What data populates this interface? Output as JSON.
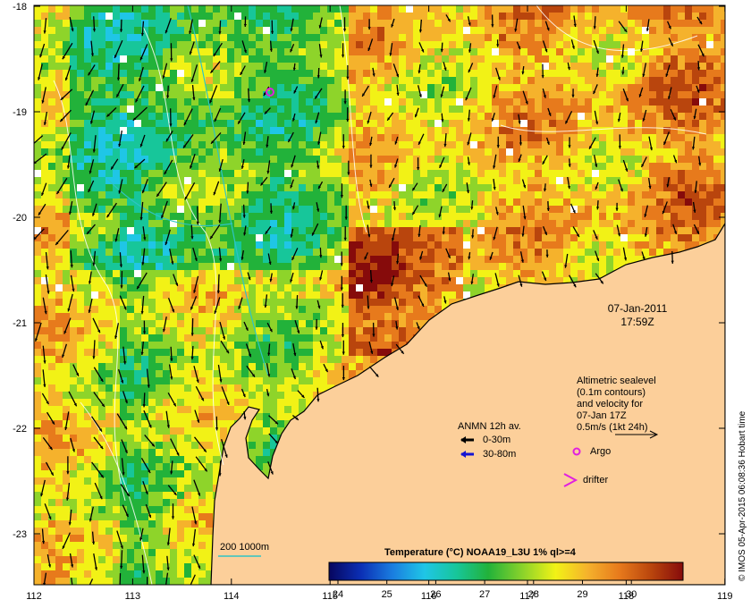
{
  "map": {
    "x_ticks": [
      "112",
      "113",
      "114",
      "115",
      "116",
      "117",
      "118",
      "119"
    ],
    "y_ticks": [
      "-18",
      "-19",
      "-20",
      "-21",
      "-22",
      "-23"
    ],
    "date": "07-Jan-2011",
    "time": "17:59Z",
    "altimetry_lines": [
      "Altimetric sealevel",
      "(0.1m contours)",
      "and velocity for",
      "07-Jan 17Z",
      "0.5m/s (1kt 24h)"
    ],
    "legend_title": "ANMN 12h av.",
    "legend_0_30": "0-30m",
    "legend_30_80": "30-80m",
    "argo_label": "Argo",
    "drifter_label": "drifter",
    "isobath_label": "200  1000m",
    "colorbar_title": "Temperature (°C) NOAA19_L3U 1% ql>=4",
    "colorbar_ticks": [
      "24",
      "25",
      "26",
      "27",
      "28",
      "29",
      "30"
    ],
    "credit": "© IMOS 05-Apr-2015 06:08:36 Hobart time",
    "colors": {
      "land": "#fccf9a",
      "temp_scale": [
        "#07065e",
        "#0b2fb5",
        "#1a7ee0",
        "#1fc6e6",
        "#17c69a",
        "#22b23a",
        "#8ed42a",
        "#f2f216",
        "#f5b22c",
        "#e77a1c",
        "#b9450d",
        "#860b0b"
      ],
      "ocean_bias": "warm"
    }
  }
}
